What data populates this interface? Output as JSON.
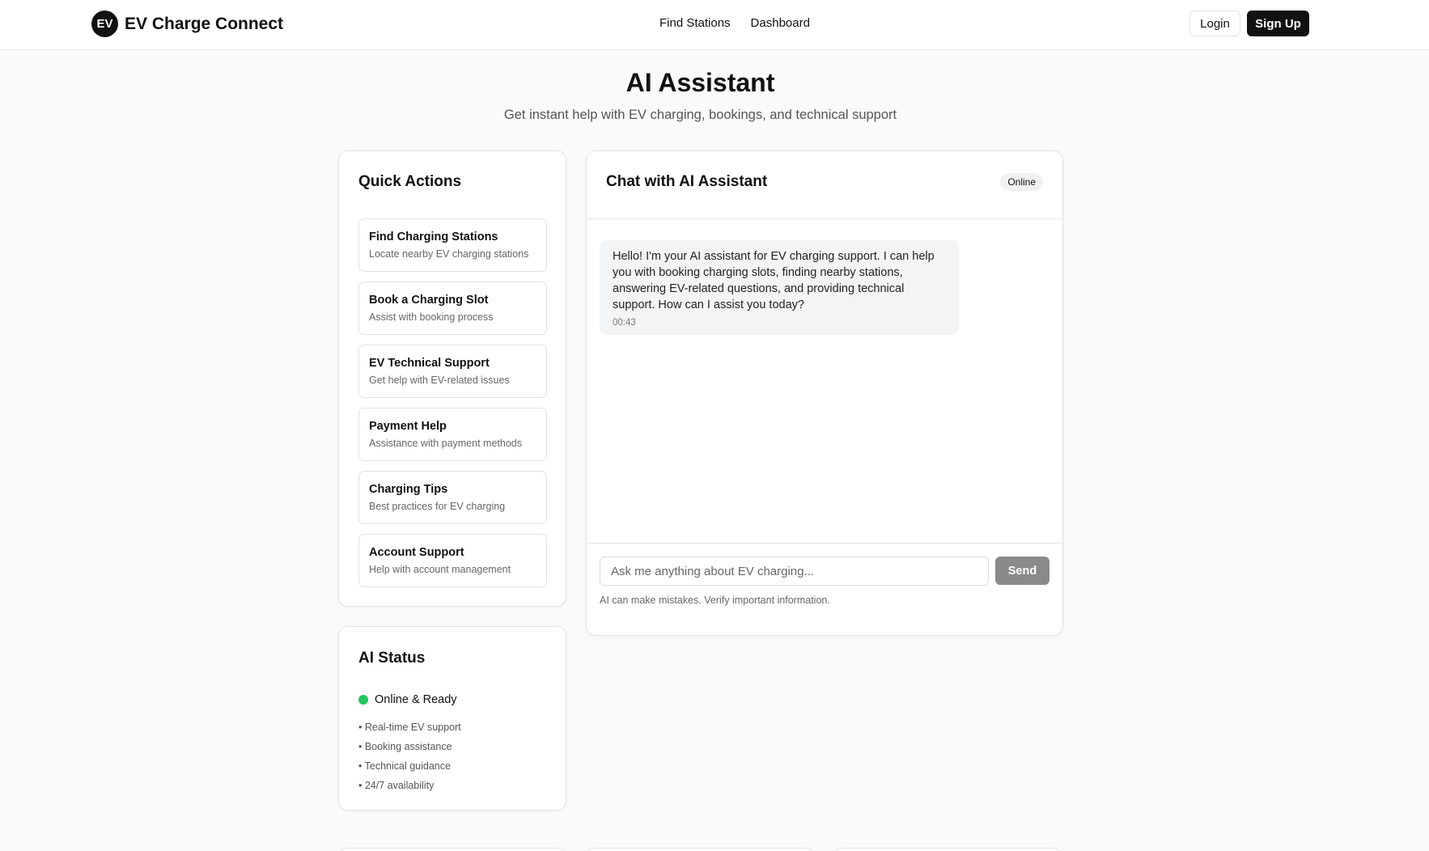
{
  "header": {
    "logo_text": "EV",
    "brand": "EV Charge Connect",
    "nav": [
      {
        "label": "Find Stations"
      },
      {
        "label": "Dashboard"
      }
    ],
    "login_label": "Login",
    "signup_label": "Sign Up"
  },
  "hero": {
    "title": "AI Assistant",
    "subtitle": "Get instant help with EV charging, bookings, and technical support"
  },
  "quick_actions": {
    "title": "Quick Actions",
    "items": [
      {
        "title": "Find Charging Stations",
        "desc": "Locate nearby EV charging stations"
      },
      {
        "title": "Book a Charging Slot",
        "desc": "Assist with booking process"
      },
      {
        "title": "EV Technical Support",
        "desc": "Get help with EV-related issues"
      },
      {
        "title": "Payment Help",
        "desc": "Assistance with payment methods"
      },
      {
        "title": "Charging Tips",
        "desc": "Best practices for EV charging"
      },
      {
        "title": "Account Support",
        "desc": "Help with account management"
      }
    ]
  },
  "ai_status": {
    "title": "AI Status",
    "status": "Online & Ready",
    "status_color": "#22c55e",
    "features": [
      "• Real-time EV support",
      "• Booking assistance",
      "• Technical guidance",
      "• 24/7 availability"
    ]
  },
  "chat": {
    "title": "Chat with AI Assistant",
    "badge": "Online",
    "messages": [
      {
        "text": "Hello! I'm your AI assistant for EV charging support. I can help you with booking charging slots, finding nearby stations, answering EV-related questions, and providing technical support. How can I assist you today?",
        "time": "00:43"
      }
    ],
    "input_placeholder": "Ask me anything about EV charging...",
    "input_value": "",
    "send_label": "Send",
    "disclaimer": "AI can make mistakes. Verify important information."
  },
  "colors": {
    "primary": "#111111",
    "send_button": "#8a8a8a",
    "status_online": "#22c55e"
  }
}
